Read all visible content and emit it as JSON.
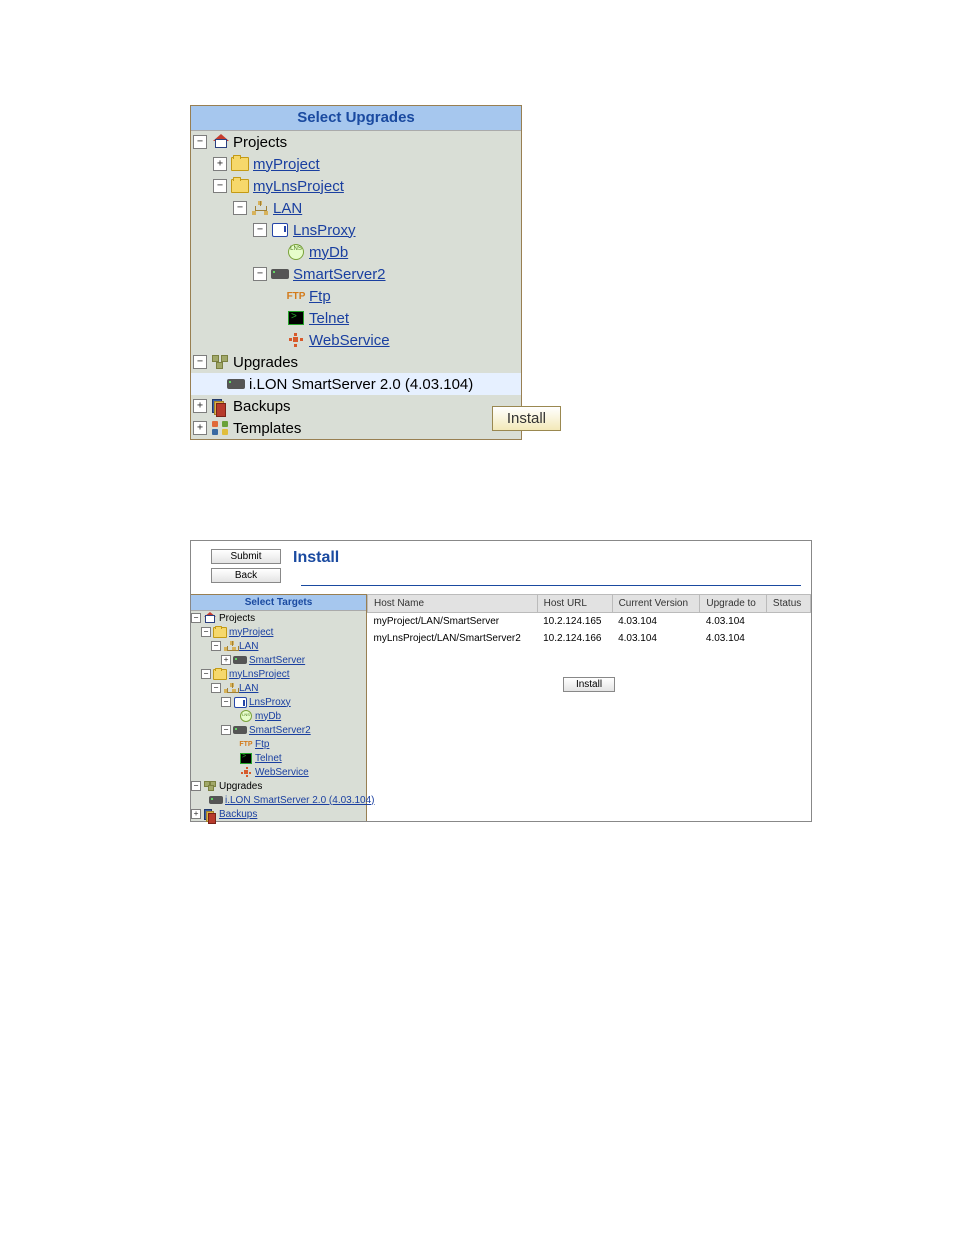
{
  "panel1": {
    "header": "Select Upgrades",
    "install_label": "Install",
    "tree": {
      "projects": "Projects",
      "myProject": "myProject",
      "myLnsProject": "myLnsProject",
      "lan": "LAN",
      "lnsProxy": "LnsProxy",
      "myDb": "myDb",
      "smartServer2": "SmartServer2",
      "ftp": "Ftp",
      "telnet": "Telnet",
      "webService": "WebService",
      "upgrades": "Upgrades",
      "ilon": "i.LON SmartServer 2.0 (4.03.104)",
      "backups": "Backups",
      "templates": "Templates"
    }
  },
  "panel2": {
    "submit": "Submit",
    "back": "Back",
    "title": "Install",
    "left_header": "Select Targets",
    "install_btn": "Install",
    "tree": {
      "projects": "Projects",
      "myProject": "myProject",
      "lan": "LAN",
      "smartServer": "SmartServer",
      "myLnsProject": "myLnsProject",
      "lan2": "LAN",
      "lnsProxy": "LnsProxy",
      "myDb": "myDb",
      "smartServer2": "SmartServer2",
      "ftp": "Ftp",
      "telnet": "Telnet",
      "webService": "WebService",
      "upgrades": "Upgrades",
      "ilon": "i.LON SmartServer 2.0 (4.03.104)",
      "backups": "Backups"
    },
    "table": {
      "headers": {
        "hostName": "Host Name",
        "hostURL": "Host URL",
        "currentVersion": "Current Version",
        "upgradeTo": "Upgrade to",
        "status": "Status"
      },
      "rows": [
        {
          "hostName": "myProject/LAN/SmartServer",
          "hostURL": "10.2.124.165",
          "currentVersion": "4.03.104",
          "upgradeTo": "4.03.104",
          "status": ""
        },
        {
          "hostName": "myLnsProject/LAN/SmartServer2",
          "hostURL": "10.2.124.166",
          "currentVersion": "4.03.104",
          "upgradeTo": "4.03.104",
          "status": ""
        }
      ]
    }
  }
}
